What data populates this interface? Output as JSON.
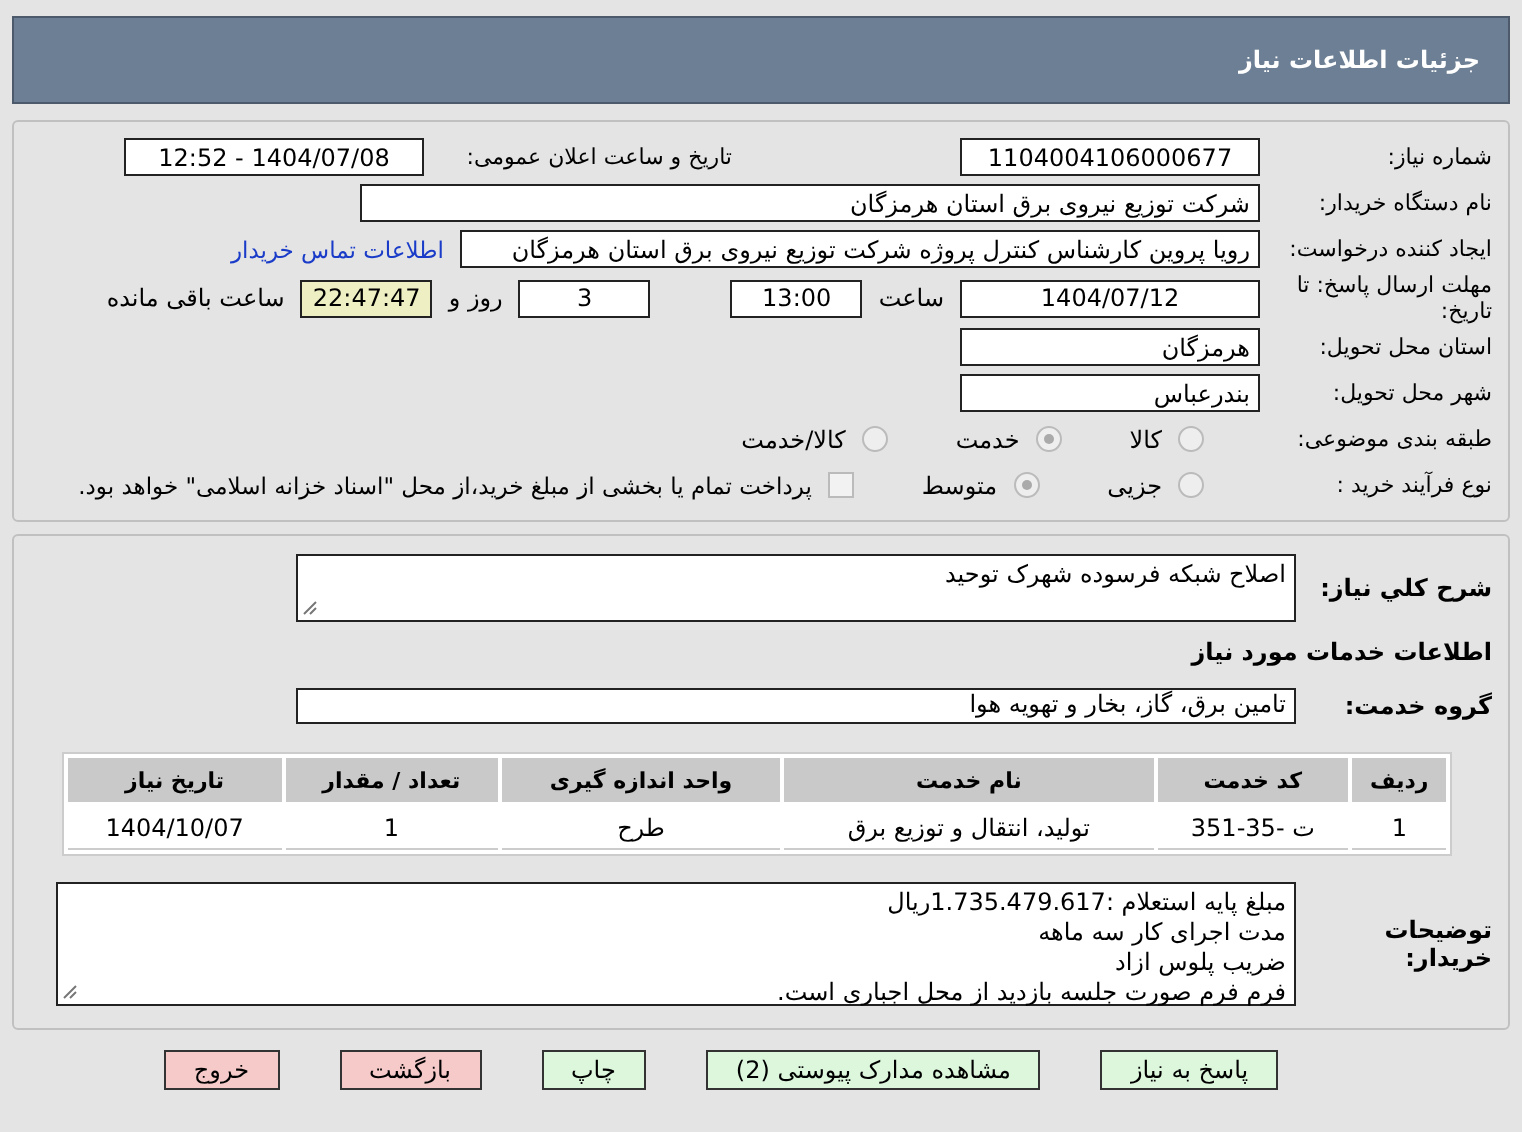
{
  "header": {
    "title": "جزئیات اطلاعات نیاز"
  },
  "need_number": {
    "label": "شماره نیاز:",
    "value": "1104004106000677"
  },
  "announce": {
    "label": "تاریخ و ساعت اعلان عمومی:",
    "value": "1404/07/08 - 12:52"
  },
  "buyer": {
    "label": "نام دستگاه خریدار:",
    "value": "شرکت توزیع نیروی برق استان هرمزگان"
  },
  "creator": {
    "label": "ایجاد کننده درخواست:",
    "value": "رویا پروین کارشناس کنترل پروژه شرکت توزیع نیروی برق استان هرمزگان",
    "link": "اطلاعات تماس خریدار"
  },
  "deadline": {
    "label": "مهلت ارسال پاسخ: تا تاریخ:",
    "date": "1404/07/12",
    "time_label": "ساعت",
    "time": "13:00",
    "days": "3",
    "days_label": "روز و",
    "remaining": "22:47:47",
    "remaining_label": "ساعت باقی مانده"
  },
  "province": {
    "label": "استان محل تحویل:",
    "value": "هرمزگان"
  },
  "city": {
    "label": "شهر محل تحویل:",
    "value": "بندرعباس"
  },
  "category": {
    "label": "طبقه بندی موضوعی:",
    "options": [
      {
        "label": "کالا",
        "selected": false
      },
      {
        "label": "خدمت",
        "selected": true
      },
      {
        "label": "کالا/خدمت",
        "selected": false
      }
    ]
  },
  "process": {
    "label": "نوع فرآیند خرید :",
    "options": [
      {
        "label": "جزیی",
        "selected": false
      },
      {
        "label": "متوسط",
        "selected": true
      }
    ],
    "payment": {
      "label": "پرداخت تمام یا بخشی از مبلغ خرید،از محل \"اسناد خزانه اسلامی\" خواهد بود.",
      "checked": false
    }
  },
  "description": {
    "label": "شرح کلي نياز:",
    "value": "اصلاح شبکه فرسوده شهرک توحید"
  },
  "services_title": "اطلاعات خدمات مورد نیاز",
  "service_group": {
    "label": "گروه خدمت:",
    "value": "تامین برق، گاز، بخار و تهویه هوا"
  },
  "table": {
    "columns": [
      "ردیف",
      "کد خدمت",
      "نام خدمت",
      "واحد اندازه گیری",
      "تعداد / مقدار",
      "تاریخ نیاز"
    ],
    "rows": [
      [
        "1",
        "ت -35-351",
        "تولید، انتقال و توزیع برق",
        "طرح",
        "1",
        "1404/10/07"
      ]
    ]
  },
  "buyer_notes": {
    "label": "توضیحات خریدار:",
    "lines": [
      "مبلغ پایه استعلام :1.735.479.617ریال",
      "مدت اجرای کار سه ماهه",
      "ضریب پلوس ازاد",
      "فرم فرم صورت جلسه بازدید از محل اجباری است."
    ]
  },
  "buttons": [
    {
      "label": "پاسخ به نیاز",
      "kind": "green"
    },
    {
      "label": "مشاهده مدارک پیوستی (2)",
      "kind": "green"
    },
    {
      "label": "چاپ",
      "kind": "green"
    },
    {
      "label": "بازگشت",
      "kind": "red"
    },
    {
      "label": "خروج",
      "kind": "red"
    }
  ]
}
